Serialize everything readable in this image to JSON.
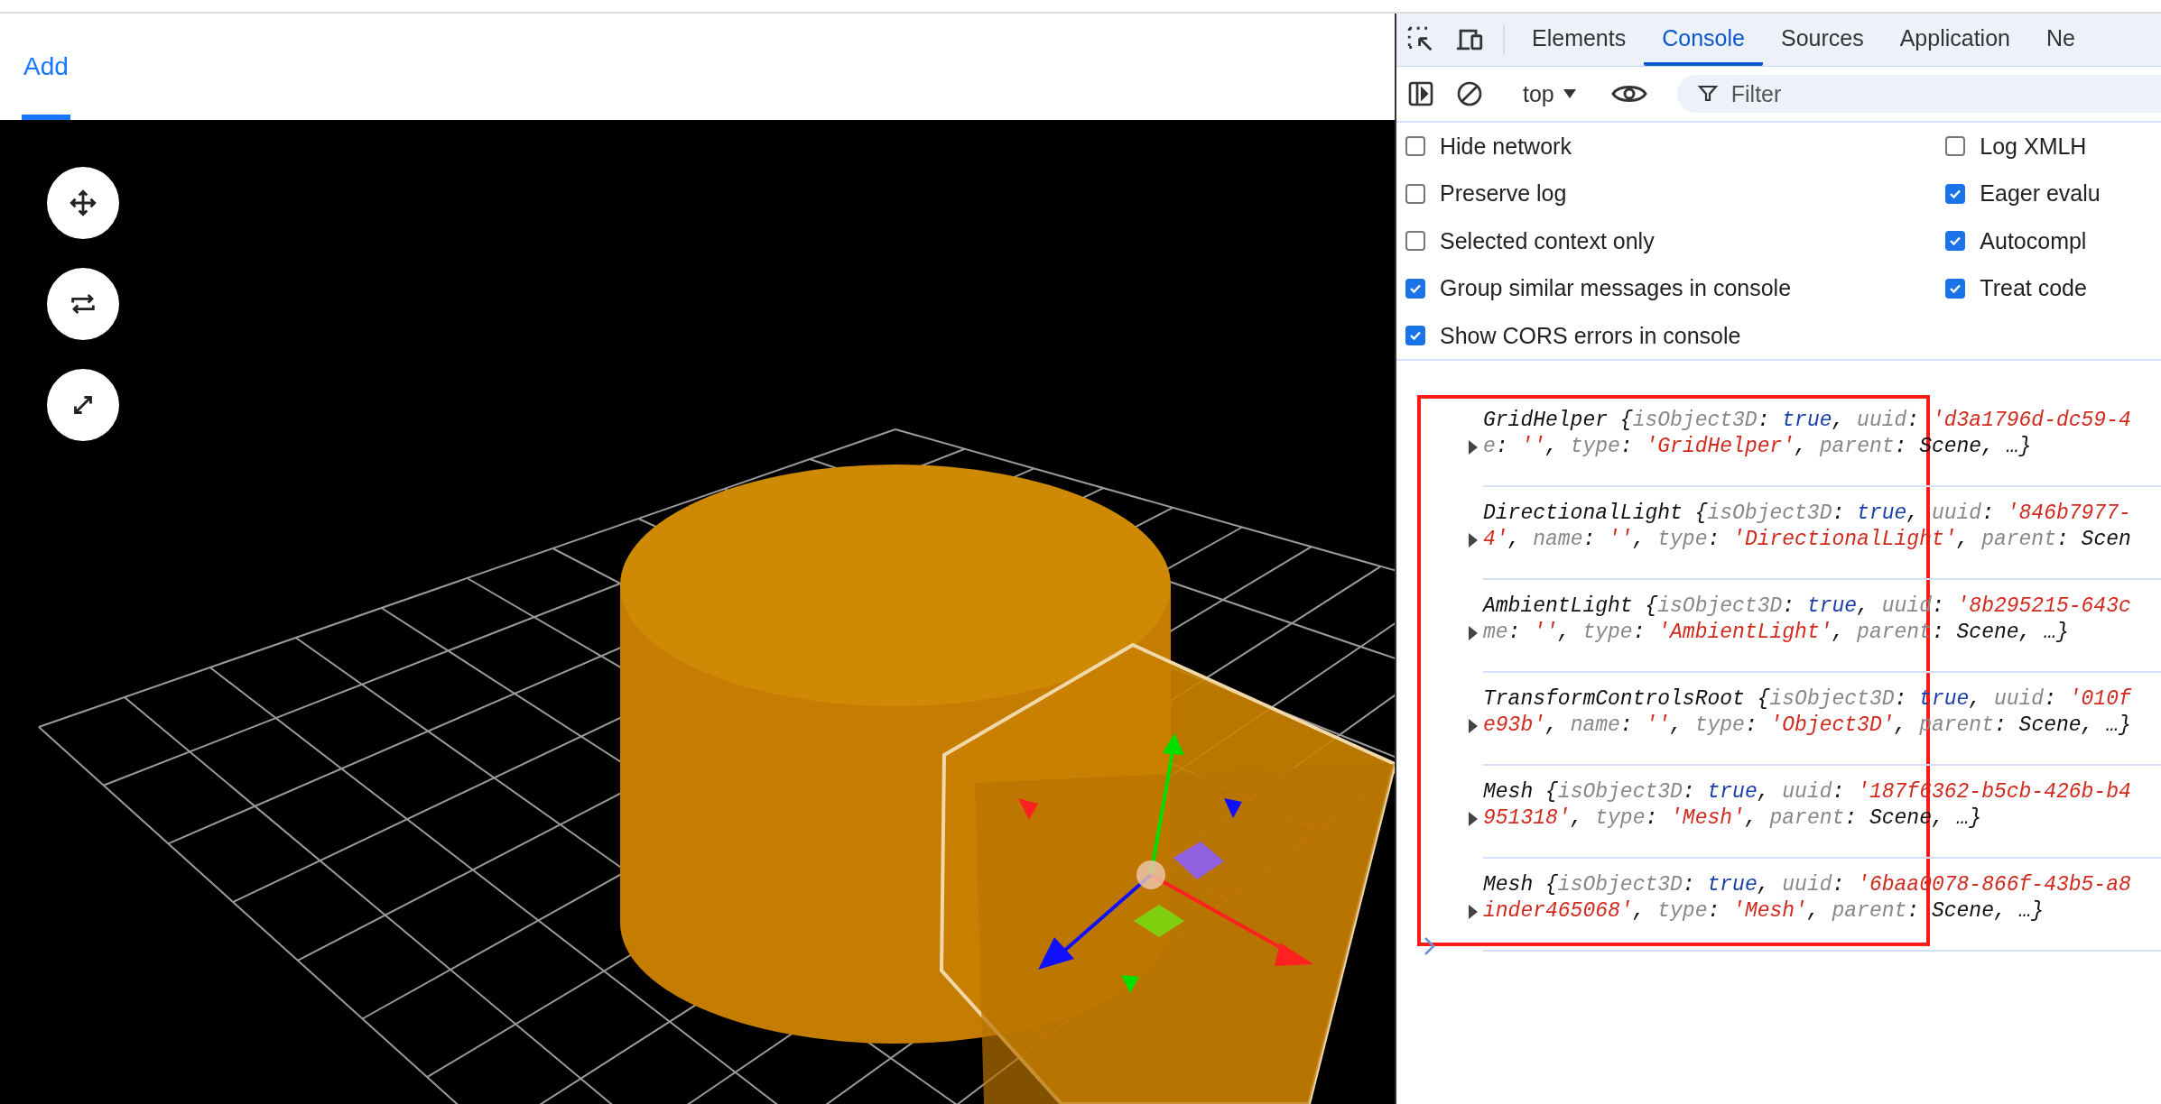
{
  "page_tabs": [
    {
      "label": "Add",
      "selected": true
    }
  ],
  "viewport": {
    "tool_buttons": [
      {
        "kind": "move"
      },
      {
        "kind": "rotate"
      },
      {
        "kind": "scale"
      }
    ]
  },
  "devtools": {
    "tabs": [
      {
        "label": "Elements",
        "selected": false
      },
      {
        "label": "Console",
        "selected": true
      },
      {
        "label": "Sources",
        "selected": false
      },
      {
        "label": "Application",
        "selected": false
      },
      {
        "label": "Ne",
        "selected": false
      }
    ],
    "context": "top",
    "filter_placeholder": "Filter",
    "settings_left": [
      {
        "label": "Hide network",
        "checked": false
      },
      {
        "label": "Preserve log",
        "checked": false
      },
      {
        "label": "Selected context only",
        "checked": false
      },
      {
        "label": "Group similar messages in console",
        "checked": true
      },
      {
        "label": "Show CORS errors in console",
        "checked": true
      }
    ],
    "settings_right": [
      {
        "label": "Log XMLH",
        "checked": false
      },
      {
        "label": "Eager evalu",
        "checked": true
      },
      {
        "label": "Autocompl",
        "checked": true
      },
      {
        "label": "Treat code",
        "checked": true
      }
    ],
    "messages": [
      {
        "lines": [
          [
            {
              "kind": "name",
              "text": "GridHelper "
            },
            {
              "kind": "punct",
              "text": "{"
            },
            {
              "kind": "key",
              "text": "isObject3D"
            },
            {
              "kind": "punct",
              "text": ": "
            },
            {
              "kind": "bool",
              "text": "true"
            },
            {
              "kind": "punct",
              "text": ", "
            },
            {
              "kind": "key",
              "text": "uuid"
            },
            {
              "kind": "punct",
              "text": ": "
            },
            {
              "kind": "str",
              "text": "'d3a1796d-dc59-4"
            }
          ],
          [
            {
              "kind": "key",
              "text": "e"
            },
            {
              "kind": "punct",
              "text": ": "
            },
            {
              "kind": "str",
              "text": "''"
            },
            {
              "kind": "punct",
              "text": ", "
            },
            {
              "kind": "key",
              "text": "type"
            },
            {
              "kind": "punct",
              "text": ": "
            },
            {
              "kind": "str",
              "text": "'GridHelper'"
            },
            {
              "kind": "punct",
              "text": ", "
            },
            {
              "kind": "key",
              "text": "parent"
            },
            {
              "kind": "punct",
              "text": ": Scene, …}"
            }
          ]
        ]
      },
      {
        "lines": [
          [
            {
              "kind": "name",
              "text": "DirectionalLight "
            },
            {
              "kind": "punct",
              "text": "{"
            },
            {
              "kind": "key",
              "text": "isObject3D"
            },
            {
              "kind": "punct",
              "text": ": "
            },
            {
              "kind": "bool",
              "text": "true"
            },
            {
              "kind": "punct",
              "text": ", "
            },
            {
              "kind": "key",
              "text": "uuid"
            },
            {
              "kind": "punct",
              "text": ": "
            },
            {
              "kind": "str",
              "text": "'846b7977-"
            }
          ],
          [
            {
              "kind": "str",
              "text": "4'"
            },
            {
              "kind": "punct",
              "text": ", "
            },
            {
              "kind": "key",
              "text": "name"
            },
            {
              "kind": "punct",
              "text": ": "
            },
            {
              "kind": "str",
              "text": "''"
            },
            {
              "kind": "punct",
              "text": ", "
            },
            {
              "kind": "key",
              "text": "type"
            },
            {
              "kind": "punct",
              "text": ": "
            },
            {
              "kind": "str",
              "text": "'DirectionalLight'"
            },
            {
              "kind": "punct",
              "text": ", "
            },
            {
              "kind": "key",
              "text": "parent"
            },
            {
              "kind": "punct",
              "text": ": Scen"
            }
          ]
        ]
      },
      {
        "lines": [
          [
            {
              "kind": "name",
              "text": "AmbientLight "
            },
            {
              "kind": "punct",
              "text": "{"
            },
            {
              "kind": "key",
              "text": "isObject3D"
            },
            {
              "kind": "punct",
              "text": ": "
            },
            {
              "kind": "bool",
              "text": "true"
            },
            {
              "kind": "punct",
              "text": ", "
            },
            {
              "kind": "key",
              "text": "uuid"
            },
            {
              "kind": "punct",
              "text": ": "
            },
            {
              "kind": "str",
              "text": "'8b295215-643c"
            }
          ],
          [
            {
              "kind": "key",
              "text": "me"
            },
            {
              "kind": "punct",
              "text": ": "
            },
            {
              "kind": "str",
              "text": "''"
            },
            {
              "kind": "punct",
              "text": ", "
            },
            {
              "kind": "key",
              "text": "type"
            },
            {
              "kind": "punct",
              "text": ": "
            },
            {
              "kind": "str",
              "text": "'AmbientLight'"
            },
            {
              "kind": "punct",
              "text": ", "
            },
            {
              "kind": "key",
              "text": "parent"
            },
            {
              "kind": "punct",
              "text": ": Scene, …}"
            }
          ]
        ]
      },
      {
        "lines": [
          [
            {
              "kind": "name",
              "text": "TransformControlsRoot "
            },
            {
              "kind": "punct",
              "text": "{"
            },
            {
              "kind": "key",
              "text": "isObject3D"
            },
            {
              "kind": "punct",
              "text": ": "
            },
            {
              "kind": "bool",
              "text": "true"
            },
            {
              "kind": "punct",
              "text": ", "
            },
            {
              "kind": "key",
              "text": "uuid"
            },
            {
              "kind": "punct",
              "text": ": "
            },
            {
              "kind": "str",
              "text": "'010f"
            }
          ],
          [
            {
              "kind": "str",
              "text": "e93b'"
            },
            {
              "kind": "punct",
              "text": ", "
            },
            {
              "kind": "key",
              "text": "name"
            },
            {
              "kind": "punct",
              "text": ": "
            },
            {
              "kind": "str",
              "text": "''"
            },
            {
              "kind": "punct",
              "text": ", "
            },
            {
              "kind": "key",
              "text": "type"
            },
            {
              "kind": "punct",
              "text": ": "
            },
            {
              "kind": "str",
              "text": "'Object3D'"
            },
            {
              "kind": "punct",
              "text": ", "
            },
            {
              "kind": "key",
              "text": "parent"
            },
            {
              "kind": "punct",
              "text": ": Scene, …}"
            }
          ]
        ]
      },
      {
        "lines": [
          [
            {
              "kind": "name",
              "text": "Mesh "
            },
            {
              "kind": "punct",
              "text": "{"
            },
            {
              "kind": "key",
              "text": "isObject3D"
            },
            {
              "kind": "punct",
              "text": ": "
            },
            {
              "kind": "bool",
              "text": "true"
            },
            {
              "kind": "punct",
              "text": ", "
            },
            {
              "kind": "key",
              "text": "uuid"
            },
            {
              "kind": "punct",
              "text": ": "
            },
            {
              "kind": "str",
              "text": "'187f6362-b5cb-426b-b4"
            }
          ],
          [
            {
              "kind": "str",
              "text": "951318'"
            },
            {
              "kind": "punct",
              "text": ", "
            },
            {
              "kind": "key",
              "text": "type"
            },
            {
              "kind": "punct",
              "text": ": "
            },
            {
              "kind": "str",
              "text": "'Mesh'"
            },
            {
              "kind": "punct",
              "text": ", "
            },
            {
              "kind": "key",
              "text": "parent"
            },
            {
              "kind": "punct",
              "text": ": Scene, …}"
            }
          ]
        ]
      },
      {
        "lines": [
          [
            {
              "kind": "name",
              "text": "Mesh "
            },
            {
              "kind": "punct",
              "text": "{"
            },
            {
              "kind": "key",
              "text": "isObject3D"
            },
            {
              "kind": "punct",
              "text": ": "
            },
            {
              "kind": "bool",
              "text": "true"
            },
            {
              "kind": "punct",
              "text": ", "
            },
            {
              "kind": "key",
              "text": "uuid"
            },
            {
              "kind": "punct",
              "text": ": "
            },
            {
              "kind": "str",
              "text": "'6baa0078-866f-43b5-a8"
            }
          ],
          [
            {
              "kind": "str",
              "text": "inder465068'"
            },
            {
              "kind": "punct",
              "text": ", "
            },
            {
              "kind": "key",
              "text": "type"
            },
            {
              "kind": "punct",
              "text": ": "
            },
            {
              "kind": "str",
              "text": "'Mesh'"
            },
            {
              "kind": "punct",
              "text": ", "
            },
            {
              "kind": "key",
              "text": "parent"
            },
            {
              "kind": "punct",
              "text": ": Scene, …}"
            }
          ]
        ]
      }
    ]
  }
}
